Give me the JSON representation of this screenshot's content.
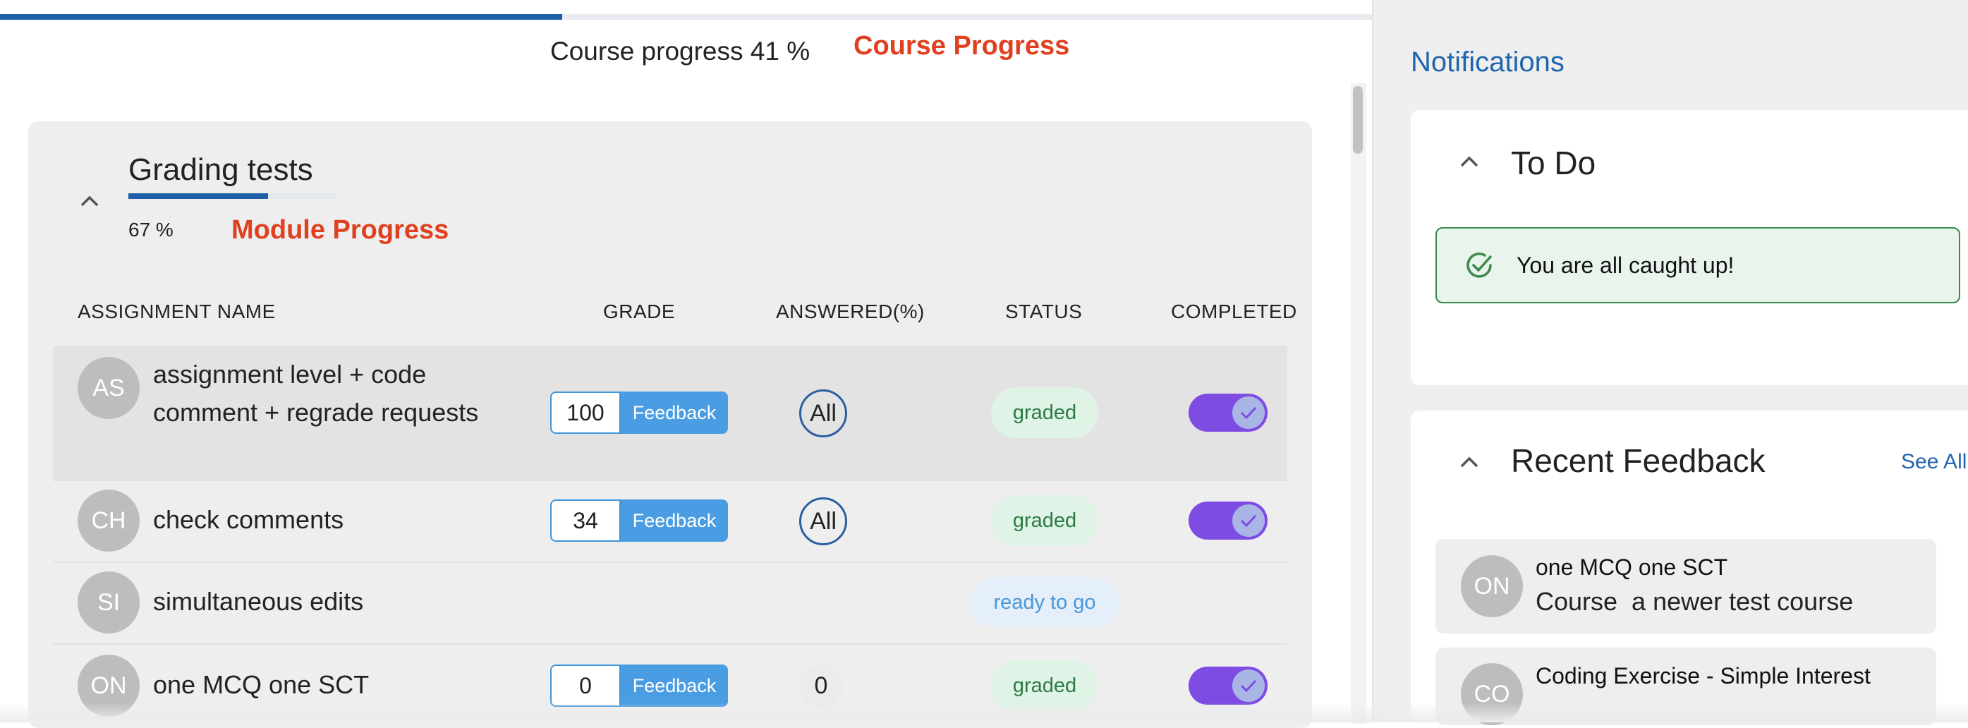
{
  "course": {
    "progress_value": 41,
    "progress_text": "Course progress 41 %",
    "annotation": "Course Progress"
  },
  "module": {
    "title": "Grading tests",
    "progress_value": 67,
    "progress_text": "67 %",
    "annotation": "Module Progress"
  },
  "table": {
    "headers": {
      "name": "ASSIGNMENT NAME",
      "grade": "GRADE",
      "answered": "ANSWERED(%)",
      "status": "STATUS",
      "completed": "COMPLETED"
    },
    "rows": [
      {
        "initials": "AS",
        "name": "assignment level + code comment + regrade requests",
        "grade": "100",
        "feedback": "Feedback",
        "answered": "All",
        "status": "graded",
        "completed": true
      },
      {
        "initials": "CH",
        "name": "check comments",
        "grade": "34",
        "feedback": "Feedback",
        "answered": "All",
        "status": "graded",
        "completed": true
      },
      {
        "initials": "SI",
        "name": "simultaneous edits",
        "grade": "",
        "feedback": "",
        "answered": "",
        "status": "ready to go",
        "completed": false
      },
      {
        "initials": "ON",
        "name": "one MCQ one SCT",
        "grade": "0",
        "feedback": "Feedback",
        "answered": "0",
        "status": "graded",
        "completed": true
      }
    ]
  },
  "notifications": {
    "title": "Notifications",
    "todo": {
      "title": "To Do",
      "message": "You are all caught up!"
    },
    "recent": {
      "title": "Recent Feedback",
      "see_all": "See All",
      "items": [
        {
          "initials": "ON",
          "title": "one MCQ one SCT",
          "subtitle": "Course  a newer test course"
        },
        {
          "initials": "CO",
          "title": "Coding Exercise - Simple Interest",
          "subtitle": ""
        }
      ]
    }
  },
  "colors": {
    "progress": "#1f5fa8",
    "annotation": "#e0401f",
    "feedback_button": "#4a9de2",
    "toggle": "#7e4be3",
    "graded_bg": "#dff3e6",
    "ready_bg": "#e4eff9",
    "link": "#2166ae"
  },
  "icons": [
    "chevron-up-icon",
    "check-circle-icon",
    "check-icon"
  ]
}
